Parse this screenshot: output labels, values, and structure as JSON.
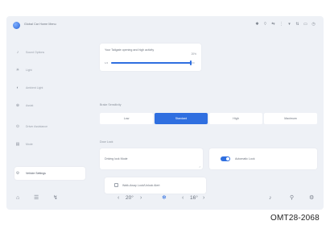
{
  "app": {
    "title": "Global Car Home Menu"
  },
  "status": {
    "icons": [
      "bt-icon",
      "wifi-icon",
      "usb-icon",
      "signal-icon",
      "lte-icon",
      "battery-icon",
      "clock-icon"
    ],
    "glyphs": [
      "✱",
      "⌔",
      "⇆",
      "⋮",
      "▾",
      "⇅",
      "▭",
      "◷"
    ]
  },
  "sidebar": {
    "items": [
      {
        "label": "Sound Options",
        "icon": "speaker-icon",
        "glyph": "♪"
      },
      {
        "label": "Light",
        "icon": "light-icon",
        "glyph": "☀"
      },
      {
        "label": "Ambient Light",
        "icon": "ambient-icon",
        "glyph": "◐"
      },
      {
        "label": "Assist",
        "icon": "assist-icon",
        "glyph": "⊕"
      },
      {
        "label": "Driver Assistance",
        "icon": "steering-icon",
        "glyph": "⊙"
      },
      {
        "label": "Mode",
        "icon": "mode-icon",
        "glyph": "▤"
      },
      {
        "label": "Vehicle Settings",
        "icon": "car-settings-icon",
        "glyph": "⚙"
      }
    ],
    "active_index": 6
  },
  "main": {
    "card1": {
      "text": "Your Tailgate opening and high activity",
      "value": "20%",
      "min_label": "1/4",
      "progress": 0.95
    },
    "section1_label": "Brake Sensitivity",
    "segments": [
      "Low",
      "Standard",
      "High",
      "Maximum"
    ],
    "segment_active": 1,
    "section2_label": "Door Lock",
    "card2_label": "Driving lock Mode",
    "card3": {
      "label": "Automatic Lock",
      "toggle_on": true
    },
    "card4": {
      "label": "Walk-Away Lock/Unlock Alert",
      "checked": false
    }
  },
  "bottom": {
    "home_glyph": "⌂",
    "vehicle_glyph": "☰",
    "fan_left_glyph": "↯",
    "temp_left": "20°",
    "fan_center_glyph": "❄",
    "temp_right": "16°",
    "music_glyph": "♪",
    "nav_glyph": "⚲",
    "settings_glyph": "⚙",
    "arrow_left": "‹",
    "arrow_right": "›"
  },
  "caption": "OMT28-2068",
  "colors": {
    "accent": "#2f6fe0",
    "background": "#eef1f6",
    "card": "#ffffff"
  }
}
